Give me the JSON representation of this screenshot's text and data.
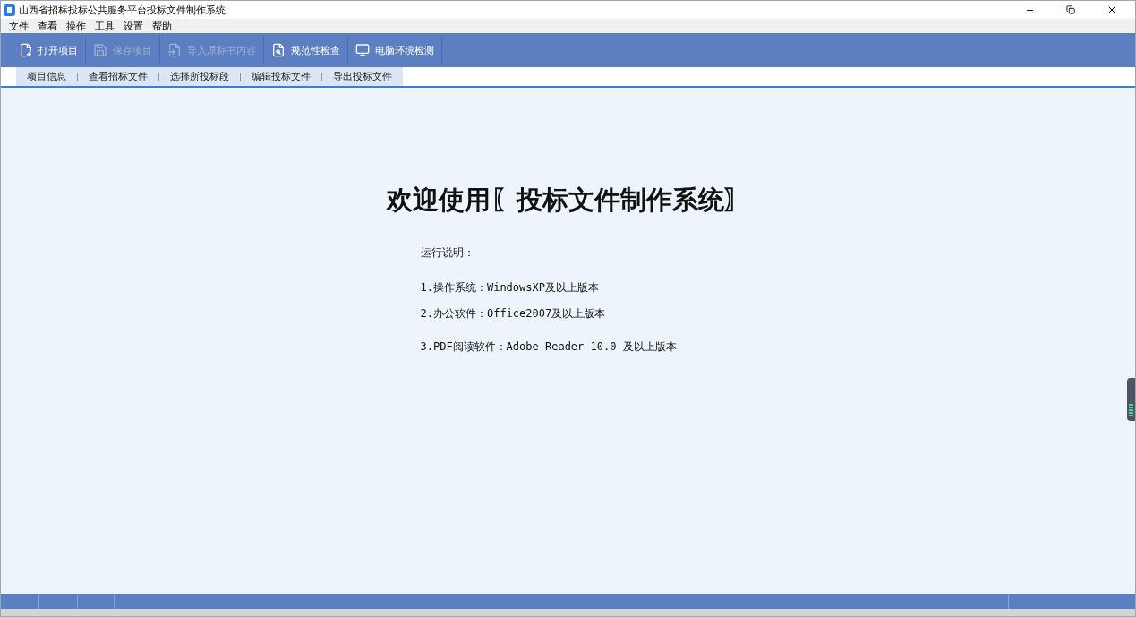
{
  "window": {
    "title": "山西省招标投标公共服务平台投标文件制作系统"
  },
  "menu": [
    "文件",
    "查看",
    "操作",
    "工具",
    "设置",
    "帮助"
  ],
  "toolbar": [
    {
      "label": "打开项目",
      "kind": "open",
      "disabled": false
    },
    {
      "label": "保存项目",
      "kind": "save",
      "disabled": true
    },
    {
      "label": "导入原标书内容",
      "kind": "import",
      "disabled": true
    },
    {
      "label": "规范性检查",
      "kind": "check",
      "disabled": false
    },
    {
      "label": "电脑环境检测",
      "kind": "monitor",
      "disabled": false
    }
  ],
  "steps": [
    "项目信息",
    "查看招标文件",
    "选择所投标段",
    "编辑投标文件",
    "导出投标文件"
  ],
  "welcome": {
    "heading": "欢迎使用〖投标文件制作系统〗",
    "intro": "运行说明：",
    "notes": [
      "1.操作系统：WindowsXP及以上版本",
      "2.办公软件：Office2007及以上版本",
      "3.PDF阅读软件：Adobe Reader 10.0 及以上版本"
    ]
  }
}
